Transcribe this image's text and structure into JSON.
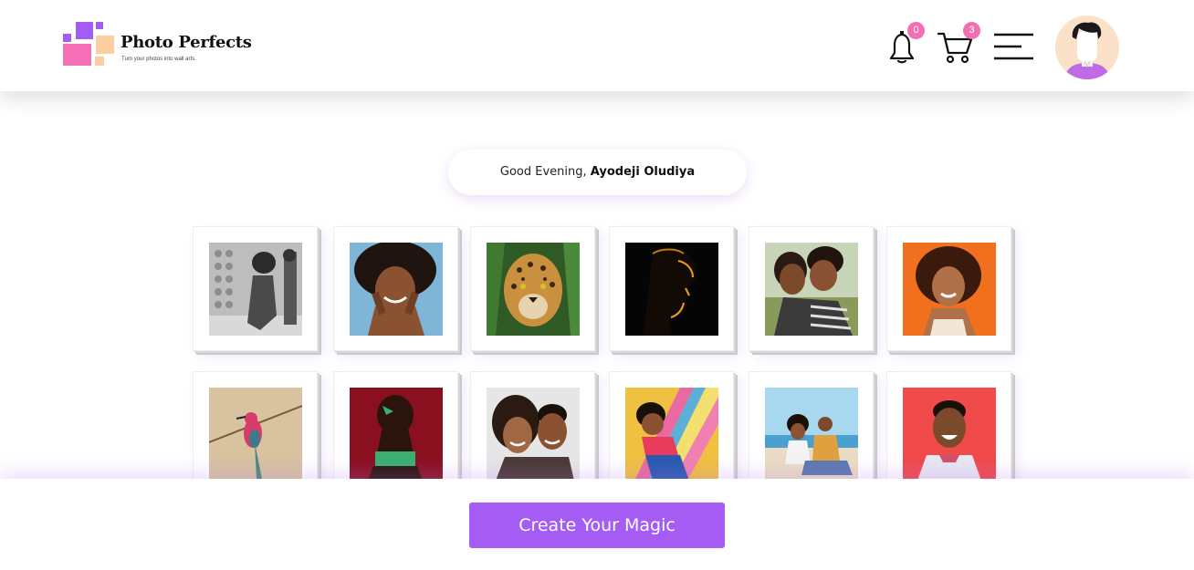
{
  "header": {
    "brand_name": "Photo Perfects",
    "brand_tagline": "Turn your photos into wall arts.",
    "notifications_count": "0",
    "cart_count": "3",
    "icons": [
      "bell-icon",
      "cart-icon",
      "hamburger-menu-icon"
    ],
    "badge_color": "#f170b4"
  },
  "greeting": {
    "prefix": "Good Evening, ",
    "name": "Ayodeji Oludiya"
  },
  "gallery": {
    "photos": [
      "woman-leaning-on-wall-bw",
      "smiling-woman-hands-on-face",
      "jaguar-in-leaves",
      "silhouette-profile-dark",
      "couple-embracing",
      "smiling-woman-orange-bg",
      "pink-bee-eater-bird",
      "woman-red-background",
      "couple-selfie",
      "woman-lying-colorful-boards",
      "couple-on-beach",
      "smiling-man-red-bg"
    ]
  },
  "cta": {
    "label": "Create Your Magic"
  },
  "colors": {
    "accent": "#a45cf5",
    "logo_pink": "#f670b8",
    "logo_purple": "#a35cf5",
    "logo_peach": "#fdcfa0"
  }
}
